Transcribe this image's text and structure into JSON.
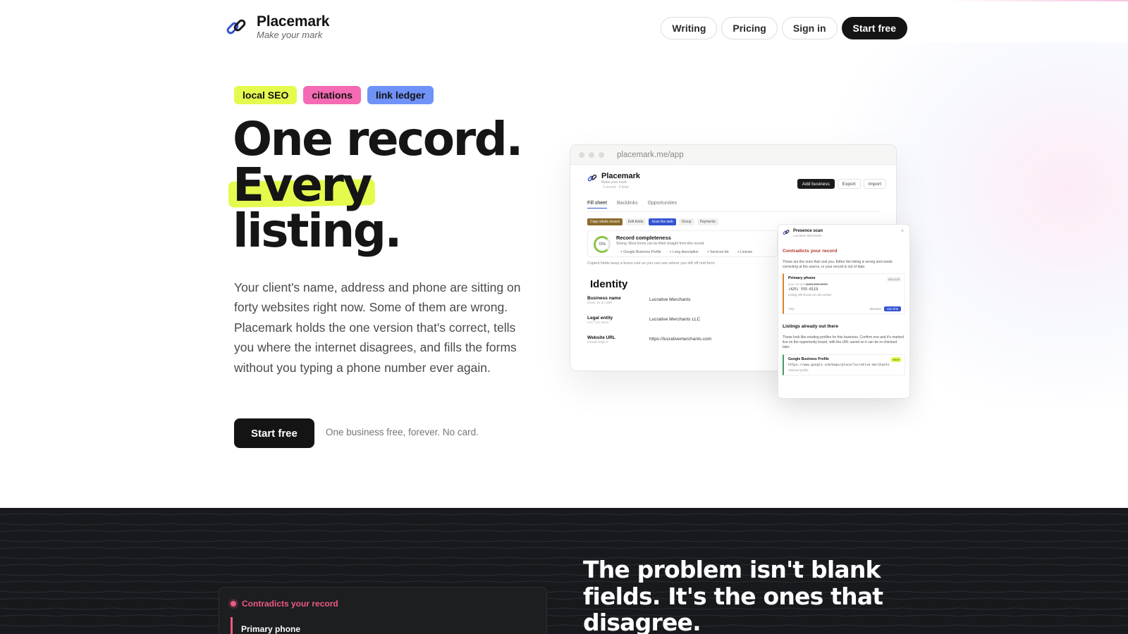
{
  "brand": {
    "name": "Placemark",
    "tagline": "Make your mark"
  },
  "nav": {
    "writing": "Writing",
    "pricing": "Pricing",
    "signin": "Sign in",
    "start": "Start free"
  },
  "tags": [
    {
      "label": "local SEO",
      "color": "#e4fb4e"
    },
    {
      "label": "citations",
      "color": "#f46bb3"
    },
    {
      "label": "link ledger",
      "color": "#6f92f7"
    }
  ],
  "hero": {
    "line1": "One record.",
    "line2": "Every",
    "line3": "listing.",
    "lede": "Your client's name, address and phone are sitting on forty websites right now. Some of them are wrong. Placemark holds the one version that's correct, tells you where the internet disagrees, and fills the forms without you typing a phone number ever again.",
    "cta": "Start free",
    "cta_note": "One business free, forever. No card."
  },
  "app": {
    "url": "placemark.me/app",
    "brand": "Placemark",
    "brand_tag": "Make your mark",
    "meta": "1 record · 0 links",
    "actions": [
      "Add business",
      "Export",
      "Import"
    ],
    "tabs": [
      "Fill sheet",
      "Backlinks",
      "Opportunities"
    ],
    "toolbar": [
      "Copy whole record",
      "Edit fields",
      "Scan the web",
      "Group",
      "Payments"
    ],
    "completeness": {
      "title": "Record completeness",
      "value": 72,
      "label": "72%",
      "sub": "Strong. Most forms can be filled straight from this record.",
      "chips": [
        "+ Google Business Profile",
        "+ Long description",
        "+ Services list",
        "+ License"
      ]
    },
    "fine": "Copied fields keep a brass rule so you can see where you left off mid-form.",
    "section": "Identity",
    "fields": [
      {
        "label": "Business name",
        "hint": "Exact, as on GBP",
        "value": "Lucrative Merchants"
      },
      {
        "label": "Legal entity",
        "hint": "LLC / Inc name",
        "value": "Lucrative Merchants LLC"
      },
      {
        "label": "Website URL",
        "hint": "Include https://",
        "value": "https://lucrativemerchants.com"
      }
    ]
  },
  "scan": {
    "title": "Presence scan",
    "sub": "Lucrative Merchants",
    "section1": "Contradicts your record",
    "p1": "These are the ones that cost you. Either the listing is wrong and needs correcting at the source, or your record is out of date.",
    "issue": {
      "field": "Primary phone",
      "badge": "MEDIUM",
      "old_label": "your record",
      "old": "(425) 000-0000",
      "new": "(425) 555-0119",
      "note": "Listing still shows an old number.",
      "source": "Yelp",
      "dismiss": "Dismiss",
      "use": "Use this"
    },
    "section2": "Listings already out there",
    "p2": "These look like existing profiles for this business. Confirm one and it's marked live on the opportunity board, with the URL saved so it can be re-checked later.",
    "listing": {
      "name": "Google Business Profile",
      "badge": "HIGH",
      "url": "https://www.google.com/maps/place/lucrative-merchants",
      "status": "Claimed profile"
    }
  },
  "problem": {
    "label": "Contradicts your record",
    "field": "Primary phone",
    "heading": "The problem isn't blank fields. It's the ones that disagree."
  },
  "colors": {
    "accent": "#e4fb4e",
    "dark": "#141414",
    "pink": "#ec5a82",
    "blue": "#3454d1"
  }
}
